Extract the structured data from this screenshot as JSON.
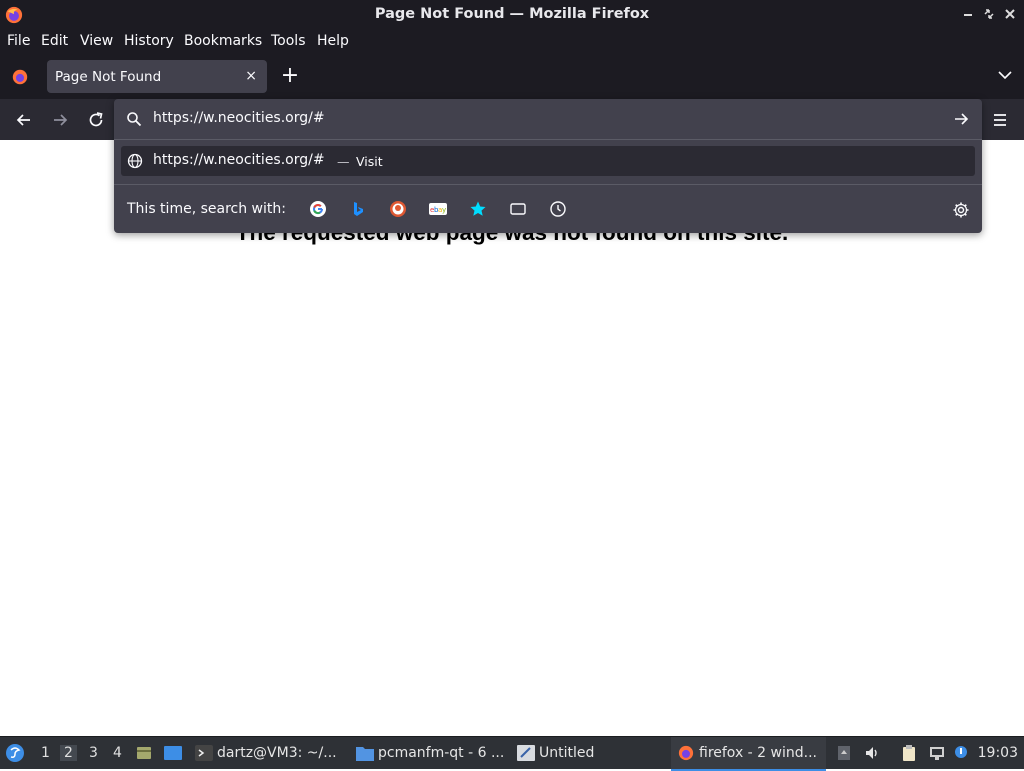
{
  "window": {
    "title": "Page Not Found — Mozilla Firefox"
  },
  "menu": [
    "File",
    "Edit",
    "View",
    "History",
    "Bookmarks",
    "Tools",
    "Help"
  ],
  "tab": {
    "label": "Page Not Found",
    "close": "×",
    "new": "+"
  },
  "urlbar": {
    "value": "https://w.neocities.org/#",
    "suggestion_url": "https://w.neocities.org/#",
    "suggestion_sep": "—",
    "suggestion_action": "Visit",
    "search_with_label": "This time, search with:",
    "engines": [
      "google-icon",
      "bing-icon",
      "duckduckgo-icon",
      "ebay-icon",
      "bookmarks-star-icon",
      "tabs-icon",
      "history-icon"
    ]
  },
  "page": {
    "heading": "The requested web page was not found on this site."
  },
  "taskbar": {
    "workspaces": [
      "1",
      "2",
      "3",
      "4"
    ],
    "active_workspace": "2",
    "tasks": [
      {
        "label": "dartz@VM3: ~/...",
        "icon": "terminal-icon"
      },
      {
        "label": "pcmanfm-qt - 6 ...",
        "icon": "folder-icon"
      },
      {
        "label": "Untitled",
        "icon": "text-editor-icon"
      },
      {
        "label": "firefox - 2 wind...",
        "icon": "firefox-icon"
      }
    ],
    "clock": "19:03"
  },
  "colors": {
    "chrome_dark": "#1c1b22",
    "navbar": "#2b2a33",
    "popup": "#42414d",
    "taskbar": "#2e3136",
    "accent": "#3d8ee6"
  }
}
